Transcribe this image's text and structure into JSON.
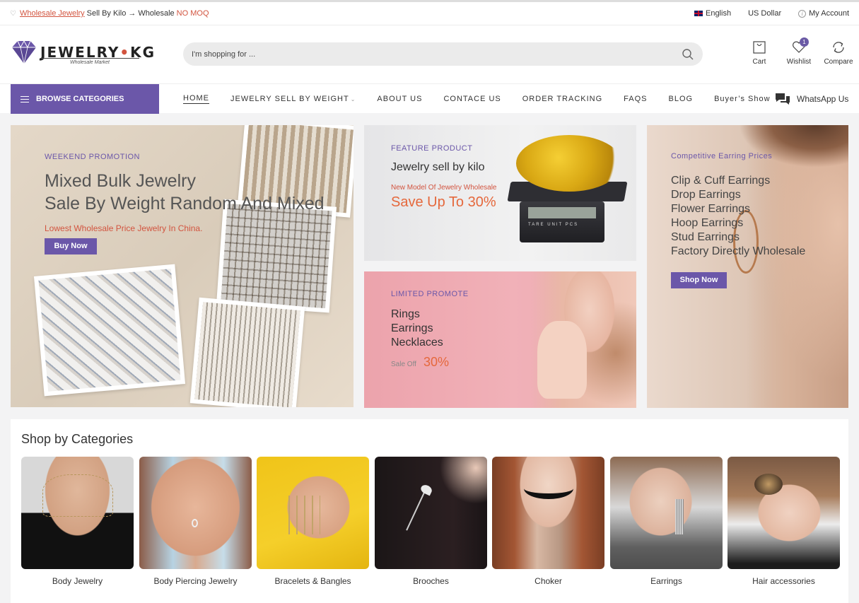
{
  "topbar": {
    "promo_link": "Wholesale Jewelry",
    "promo_mid": "Sell By Kilo",
    "promo_arrow": "→",
    "promo_end": "Wholesale",
    "promo_red": "NO MOQ",
    "language": "English",
    "currency": "US Dollar",
    "account": "My Account"
  },
  "header": {
    "brand_left": "JEWELRY",
    "brand_dot": "•",
    "brand_right": "KG",
    "brand_sub": "Wholesale Market",
    "search_placeholder": "I'm shopping for ...",
    "cart_label": "Cart",
    "wishlist_label": "Wishlist",
    "wishlist_count": "1",
    "compare_label": "Compare"
  },
  "nav": {
    "browse_label": "BROWSE CATEGORIES",
    "items": [
      {
        "label": "HOME"
      },
      {
        "label": "JEWELRY SELL BY WEIGHT"
      },
      {
        "label": "ABOUT US"
      },
      {
        "label": "CONTACE US"
      },
      {
        "label": "ORDER TRACKING"
      },
      {
        "label": "FAQS"
      },
      {
        "label": "BLOG"
      },
      {
        "label": "Buyer’s Show"
      }
    ],
    "whatsapp_label": "WhatsApp Us"
  },
  "banners": {
    "main": {
      "tag": "WEEKEND PROMOTION",
      "title_line1": "Mixed Bulk Jewelry",
      "title_line2": "Sale By Weight Random And Mixed",
      "subtitle": "Lowest Wholesale Price Jewelry In China.",
      "button": "Buy Now"
    },
    "feature": {
      "tag": "FEATURE PRODUCT",
      "title": "Jewelry sell by kilo",
      "subtitle": "New Model Of Jewelry Wholesale",
      "big": "Save Up To 30%"
    },
    "limited": {
      "tag": "LIMITED PROMOTE",
      "lines": [
        "Rings",
        "Earrings",
        "Necklaces"
      ],
      "sale_label": "Sale Off",
      "sale_pct": "30%"
    },
    "earring": {
      "tag": "Competitive Earring Prices",
      "lines": [
        "Clip & Cuff Earrings",
        "Drop Earrings",
        "Flower Earrings",
        "Hoop Earrings",
        "Stud Earrings",
        "Factory Directly Wholesale"
      ],
      "button": "Shop Now"
    }
  },
  "categories": {
    "heading": "Shop by Categories",
    "items": [
      {
        "label": "Body Jewelry"
      },
      {
        "label": "Body Piercing Jewelry"
      },
      {
        "label": "Bracelets & Bangles"
      },
      {
        "label": "Brooches"
      },
      {
        "label": "Choker"
      },
      {
        "label": "Earrings"
      },
      {
        "label": "Hair accessories"
      }
    ]
  },
  "colors": {
    "accent": "#6b57a9",
    "promo_red": "#d2543f",
    "sale_orange": "#e5683c"
  },
  "icons": [
    "heart-icon",
    "uk-flag-icon",
    "info-icon",
    "search-icon",
    "cart-icon",
    "wishlist-heart-icon",
    "compare-icon",
    "menu-icon",
    "chevron-down-icon",
    "whatsapp-chat-icon"
  ]
}
